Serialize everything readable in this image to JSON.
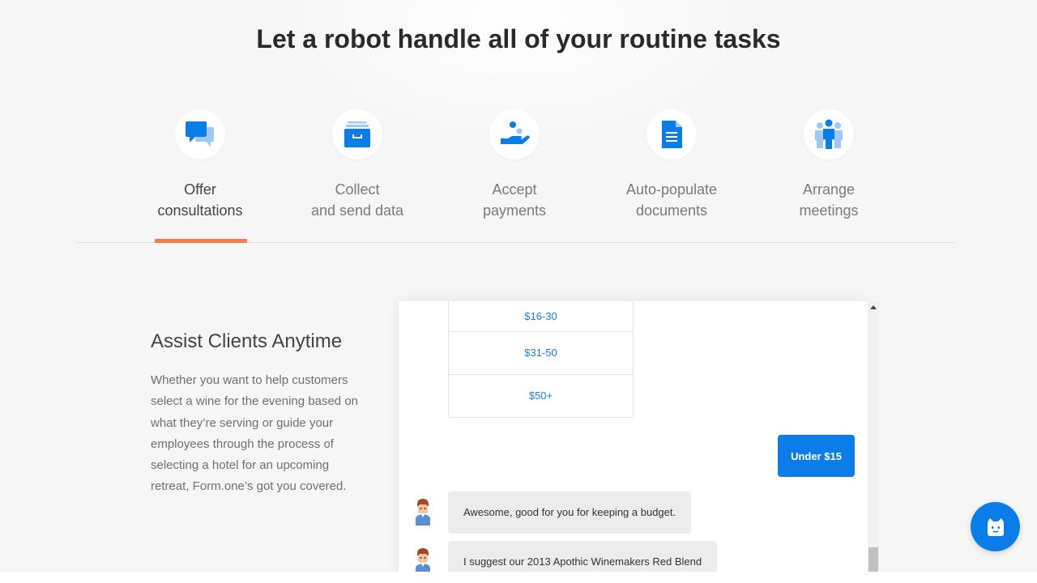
{
  "hero": {
    "headline": "Let a robot handle all of your routine tasks"
  },
  "features": [
    {
      "icon": "chat-bubbles-icon",
      "line1": "Offer",
      "line2": "consultations",
      "active": true
    },
    {
      "icon": "archive-box-icon",
      "line1": "Collect",
      "line2": "and send data",
      "active": false
    },
    {
      "icon": "hand-coins-icon",
      "line1": "Accept",
      "line2": "payments",
      "active": false
    },
    {
      "icon": "document-icon",
      "line1": "Auto-populate",
      "line2": "documents",
      "active": false
    },
    {
      "icon": "people-group-icon",
      "line1": "Arrange",
      "line2": "meetings",
      "active": false
    }
  ],
  "section": {
    "title": "Assist Clients Anytime",
    "text": "Whether you want to help customers select a wine for the evening based on what they’re serving or guide your employees through the process of selecting a hotel for an upcoming retreat, Form.one’s got you covered."
  },
  "chat": {
    "options": [
      "$16-30",
      "$31-50",
      "$50+"
    ],
    "user_reply": "Under $15",
    "bot_messages": [
      "Awesome, good for you for keeping a budget.",
      "I suggest our 2013 Apothic Winemakers Red Blend"
    ]
  },
  "colors": {
    "accent_blue": "#0a7de8",
    "light_blue": "#9cc9f5",
    "active_underline": "#f47b4d"
  },
  "launcher": {
    "icon": "chatbot-face-icon"
  }
}
